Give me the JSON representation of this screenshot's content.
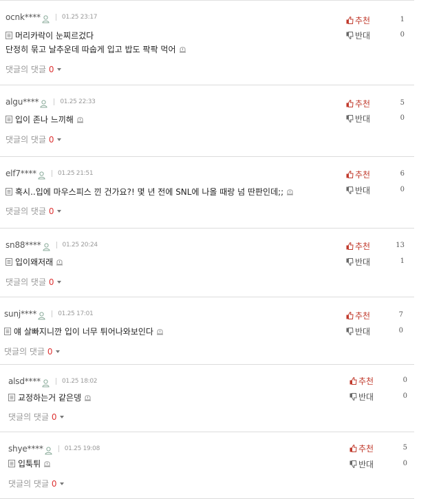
{
  "labels": {
    "reply_prefix": "댓글의 댓글",
    "upvote": "추천",
    "downvote": "반대"
  },
  "comments": [
    {
      "user": "ocnk****",
      "time": "01.25 23:17",
      "lines": [
        "머리카락이 눈찌르겄다",
        "단정히 묶고 날추운데 따숩게 입고 밥도 팍팍 먹어"
      ],
      "replies": "0",
      "up": "1",
      "down": "0"
    },
    {
      "user": "algu****",
      "time": "01.25 22:33",
      "lines": [
        "입이 존나 느끼해"
      ],
      "replies": "0",
      "up": "5",
      "down": "0"
    },
    {
      "user": "elf7****",
      "time": "01.25 21:51",
      "lines": [
        "혹시..입에 마우스피스 낀 건가요?! 몇 년 전에 SNL에 나올 때랑 넘 딴판인데;;"
      ],
      "replies": "0",
      "up": "6",
      "down": "0"
    },
    {
      "user": "sn88****",
      "time": "01.25 20:24",
      "lines": [
        "입이왜저래"
      ],
      "replies": "0",
      "up": "13",
      "down": "1"
    },
    {
      "user": "sunj****",
      "time": "01.25 17:01",
      "lines": [
        "얘 살빠지니깐 입이 너무 튀어나와보인다"
      ],
      "replies": "0",
      "up": "7",
      "down": "0"
    },
    {
      "user": "alsd****",
      "time": "01.25 18:02",
      "lines": [
        "교정하는거 같은뎅"
      ],
      "replies": "0",
      "up": "0",
      "down": "0"
    },
    {
      "user": "shye****",
      "time": "01.25 19:08",
      "lines": [
        "입툭튀"
      ],
      "replies": "0",
      "up": "5",
      "down": "0"
    }
  ],
  "colors": {
    "upvote": "#c0392b",
    "reply_count": "#dd3333",
    "divider": "#dcdcdc"
  }
}
